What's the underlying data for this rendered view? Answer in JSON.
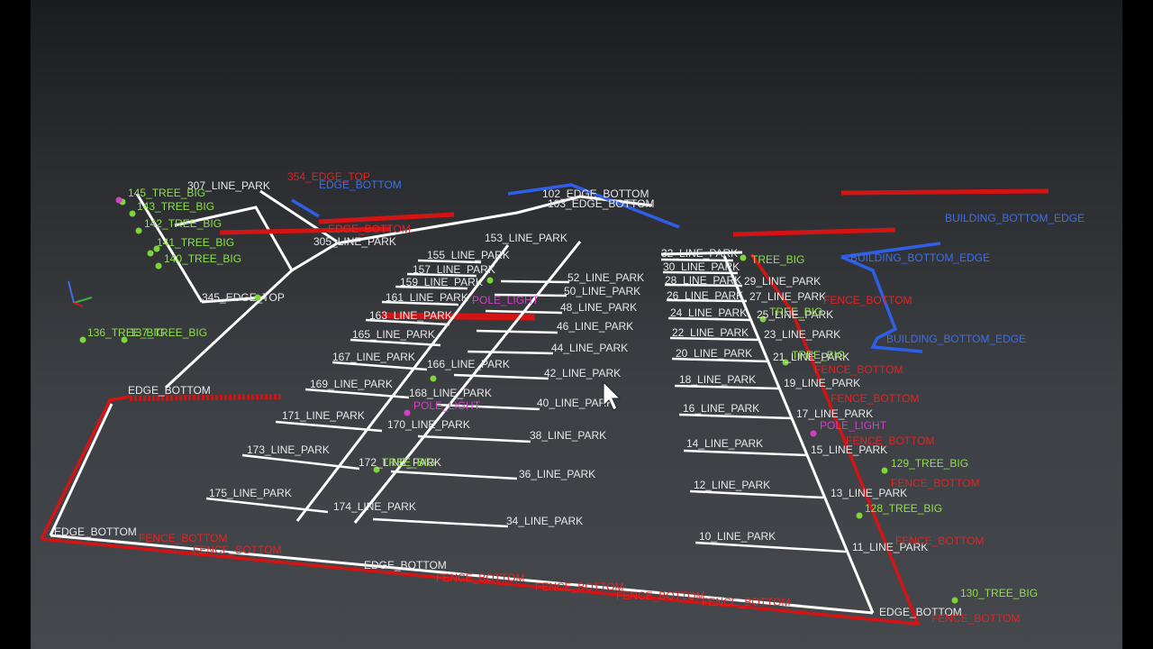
{
  "colors": {
    "line": "#ffffff",
    "fence": "#d41414",
    "tree": "#7cd63a",
    "label_white": "#e8e8e8",
    "label_red": "#e02424",
    "label_green": "#8fe04a",
    "label_blue": "#3f6fe8",
    "label_magenta": "#d43fc8"
  },
  "cursor_icon": "mouse-pointer-icon",
  "axis_icon": "axis-gizmo-icon",
  "labels_white": [
    "10_LINE_PARK",
    "11_LINE_PARK",
    "12_LINE_PARK",
    "13_LINE_PARK",
    "14_LINE_PARK",
    "15_LINE_PARK",
    "16_LINE_PARK",
    "17_LINE_PARK",
    "18_LINE_PARK",
    "19_LINE_PARK",
    "20_LINE_PARK",
    "21_LINE_PARK",
    "22_LINE_PARK",
    "23_LINE_PARK",
    "24_LINE_PARK",
    "25_LINE_PARK",
    "26_LINE_PARK",
    "27_LINE_PARK",
    "28_LINE_PARK",
    "29_LINE_PARK",
    "30_LINE_PARK",
    "32_LINE_PARK",
    "34_LINE_PARK",
    "36_LINE_PARK",
    "38_LINE_PARK",
    "40_LINE_PARK",
    "42_LINE_PARK",
    "44_LINE_PARK",
    "46_LINE_PARK",
    "48_LINE_PARK",
    "50_LINE_PARK",
    "52_LINE_PARK",
    "153_LINE_PARK",
    "155_LINE_PARK",
    "157_LINE_PARK",
    "159_LINE_PARK",
    "161_LINE_PARK",
    "163_LINE_PARK",
    "165_LINE_PARK",
    "167_LINE_PARK",
    "169_LINE_PARK",
    "171_LINE_PARK",
    "173_LINE_PARK",
    "175_LINE_PARK",
    "174_LINE_PARK",
    "172_LINE_PARK",
    "170_LINE_PARK",
    "168_LINE_PARK",
    "166_LINE_PARK",
    "305_LINE_PARK",
    "307_LINE_PARK",
    "102_EDGE_BOTTOM",
    "103_EDGE_BOTTOM",
    "EDGE_BOTTOM",
    "345_EDGE_TOP",
    "EDGE_BOTTOM",
    "EDGE_BOTTOM",
    "EDGE_BOTTOM"
  ],
  "labels_red": [
    "FENCE_BOTTOM",
    "FENCE_BOTTOM",
    "FENCE_BOTTOM",
    "FENCE_BOTTOM",
    "FENCE_BOTTOM",
    "FENCE_BOTTOM",
    "FENCE_BOTTOM",
    "FENCE_BOTTOM",
    "FENCE_BOTTOM",
    "FENCE_BOTTOM",
    "FENCE_BOTTOM",
    "FENCE_BOTTOM",
    "354_EDGE_TOP",
    "EDGE_BOTTOM",
    "FENCE_BOTTOM"
  ],
  "labels_green": [
    "129_TREE_BIG",
    "128_TREE_BIG",
    "130_TREE_BIG",
    "136_TREE_BIG",
    "137_TREE_BIG",
    "143_TREE_BIG",
    "142_TREE_BIG",
    "141_TREE_BIG",
    "140_TREE_BIG",
    "145_TREE_BIG",
    "TREE_BIG",
    "TREE_BIG",
    "TREE_BIG",
    "TREE_BIG"
  ],
  "labels_blue": [
    "BUILDING_BOTTOM_EDGE",
    "BUILDING_BOTTOM_EDGE",
    "EDGE_BOTTOM",
    "BUILDING_BOTTOM_EDGE"
  ],
  "labels_magenta": [
    "POLE_LIGHT",
    "POLE_LIGHT",
    "POLE_LIGHT"
  ]
}
